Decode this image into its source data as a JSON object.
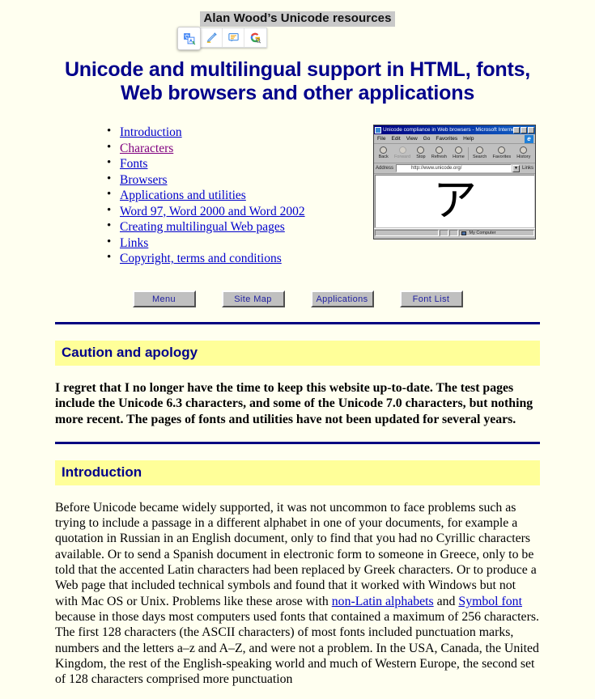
{
  "site": {
    "title": "Alan Wood’s Unicode resources",
    "page_heading_line1": "Unicode and multilingual support in HTML, fonts,",
    "page_heading_line2": "Web browsers and other applications"
  },
  "translate_popup": {
    "icons": [
      {
        "name": "google-translate-icon",
        "glyph": "G"
      },
      {
        "name": "highlight-pen-icon",
        "glyph": "✎"
      },
      {
        "name": "comment-bubble-icon",
        "glyph": "▤"
      },
      {
        "name": "google-search-icon",
        "glyph": "G"
      }
    ]
  },
  "nav": {
    "items": [
      {
        "label": "Introduction",
        "visited": false
      },
      {
        "label": "Characters",
        "visited": true
      },
      {
        "label": "Fonts",
        "visited": false
      },
      {
        "label": "Browsers",
        "visited": false
      },
      {
        "label": "Applications and utilities",
        "visited": false
      },
      {
        "label": "Word 97, Word 2000 and Word 2002",
        "visited": false
      },
      {
        "label": "Creating multilingual Web pages",
        "visited": false
      },
      {
        "label": "Links",
        "visited": false
      },
      {
        "label": "Copyright, terms and conditions",
        "visited": false
      }
    ]
  },
  "ie_screenshot": {
    "window_title": "Unicode compliance in Web browsers - Microsoft Internet Explorer",
    "menu_items": [
      "File",
      "Edit",
      "View",
      "Go",
      "Favorites",
      "Help"
    ],
    "toolbar_buttons": [
      {
        "label": "Back",
        "disabled": false
      },
      {
        "label": "Forward",
        "disabled": true
      },
      {
        "label": "Stop",
        "disabled": false
      },
      {
        "label": "Refresh",
        "disabled": false
      },
      {
        "label": "Home",
        "disabled": false
      },
      {
        "label": "Search",
        "disabled": false
      },
      {
        "label": "Favorites",
        "disabled": false
      },
      {
        "label": "History",
        "disabled": false
      }
    ],
    "address_label": "Address",
    "address_value": "http://www.unicode.org/",
    "links_label": "Links",
    "content_character": "ア",
    "status_zone": "My Computer",
    "window_controls": [
      "minimize",
      "maximize",
      "close"
    ],
    "browser_logo_letter": "e"
  },
  "buttons": [
    {
      "label": "Menu"
    },
    {
      "label": "Site Map"
    },
    {
      "label": "Applications"
    },
    {
      "label": "Font List"
    }
  ],
  "sections": [
    {
      "heading": "Caution and apology",
      "paragraph": "I regret that I no longer have the time to keep this website up-to-date. The test pages include the Unicode 6.3 characters, and some of the Unicode 7.0 characters, but nothing more recent. The pages of fonts and utilities have not been updated for several years."
    },
    {
      "heading": "Introduction",
      "text_part1": "Before Unicode became widely supported, it was not uncommon to face problems such as trying to include a passage in a different alphabet in one of your documents, for example a quotation in Russian in an English document, only to find that you had no Cyrillic characters available. Or to send a Spanish document in electronic form to someone in Greece, only to be told that the accented Latin characters had been replaced by Greek characters. Or to produce a Web page that included technical symbols and found that it worked with Windows but not with Mac OS or Unix. Problems like these arose with ",
      "link1": "non-Latin alphabets",
      "text_part2": " and ",
      "link2": "Symbol font",
      "text_part3": " because in those days most computers used fonts that contained a maximum of 256 characters. The first 128 characters (the ASCII characters) of most fonts included punctuation marks, numbers and the letters a–z and A–Z, and were not a problem. In the USA, Canada, the United Kingdom, the rest of the English-speaking world and much of Western Europe, the second set of 128 characters comprised more punctuation"
    }
  ],
  "colors": {
    "page_background": "#fffff0",
    "heading_navy": "#00008b",
    "section_highlight": "#ffff99",
    "link_blue": "#0000cc",
    "link_visited": "#800080",
    "rule_navy": "#000080",
    "selection_gray": "#c9c9c9"
  }
}
